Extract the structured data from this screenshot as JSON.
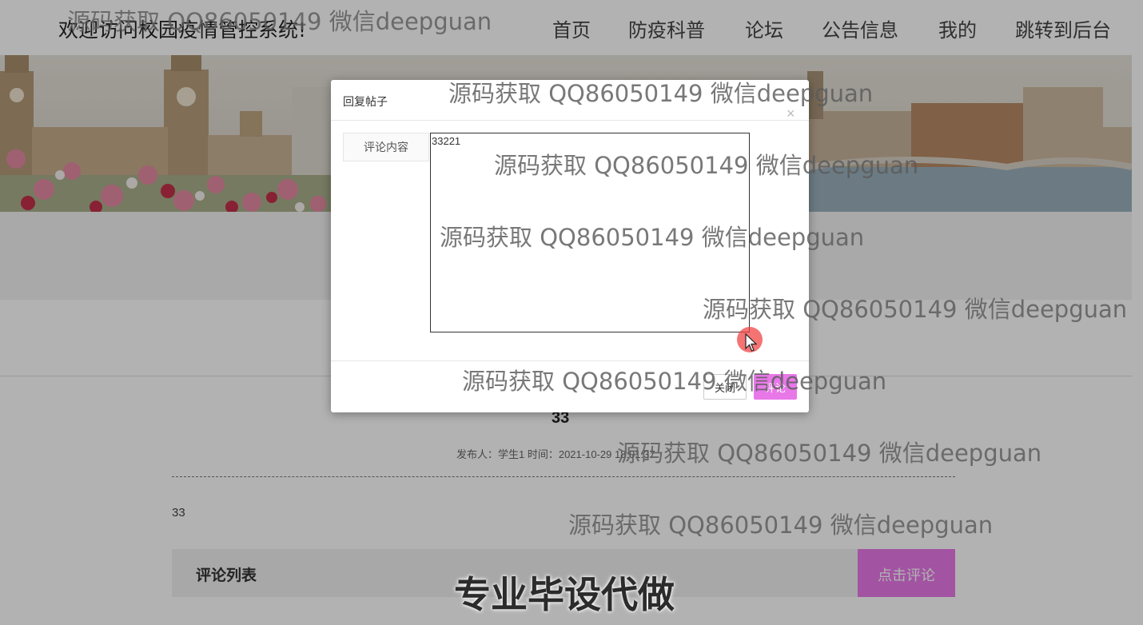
{
  "header": {
    "site_title": "欢迎访问校园疫情管控系统!",
    "nav": [
      "首页",
      "防疫科普",
      "论坛",
      "公告信息",
      "我的",
      "跳转到后台"
    ]
  },
  "post": {
    "title": "33",
    "meta": "发布人：学生1 时间：2021-10-29 18:01:37",
    "content": "33"
  },
  "comments": {
    "title": "评论列表",
    "button": "点击评论"
  },
  "modal": {
    "title": "回复帖子",
    "close": "×",
    "label": "评论内容",
    "textarea_value": "33221",
    "cancel": "关闭",
    "submit": "评论"
  },
  "watermark": "源码获取 QQ86050149 微信deepguan",
  "promo": "专业毕设代做",
  "colors": {
    "accent": "#e878e8",
    "cursor": "#f04646"
  }
}
